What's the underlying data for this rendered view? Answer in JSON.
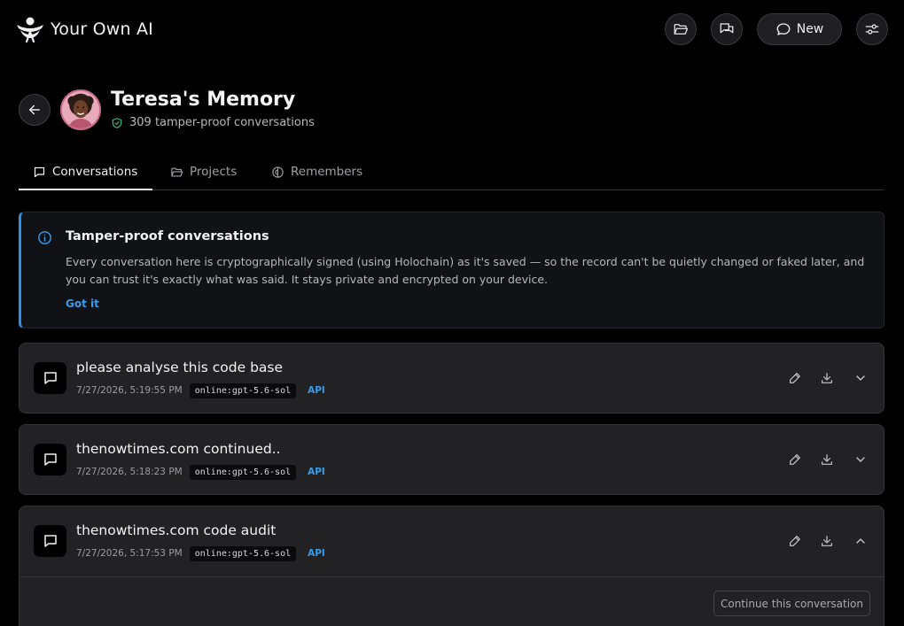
{
  "app": {
    "name": "Your Own AI"
  },
  "header": {
    "new_label": "New",
    "icons": [
      "folder-open-icon",
      "chats-icon",
      "chat-bubble-icon",
      "sliders-icon"
    ]
  },
  "profile": {
    "title": "Teresa's Memory",
    "subtitle": "309 tamper-proof conversations"
  },
  "tabs": [
    {
      "label": "Conversations",
      "icon": "message-square-icon",
      "active": true
    },
    {
      "label": "Projects",
      "icon": "folder-icon",
      "active": false
    },
    {
      "label": "Remembers",
      "icon": "brain-icon",
      "active": false
    }
  ],
  "info": {
    "title": "Tamper-proof conversations",
    "body": "Every conversation here is cryptographically signed (using Holochain) as it's saved — so the record can't be quietly changed or faked later, and you can trust it's exactly what was said. It stays private and encrypted on your device.",
    "dismiss_label": "Got it"
  },
  "conversations": [
    {
      "title": "please analyse this code base",
      "date": "7/27/2026, 5:19:55 PM",
      "model": "online:gpt-5.6-sol",
      "source": "API",
      "expanded": false
    },
    {
      "title": "thenowtimes.com continued..",
      "date": "7/27/2026, 5:18:23 PM",
      "model": "online:gpt-5.6-sol",
      "source": "API",
      "expanded": false
    },
    {
      "title": "thenowtimes.com code audit",
      "date": "7/27/2026, 5:17:53 PM",
      "model": "online:gpt-5.6-sol",
      "source": "API",
      "expanded": true,
      "continue_label": "Continue this conversation"
    }
  ],
  "colors": {
    "accent": "#3a9be8",
    "background": "#000000",
    "card": "#222225",
    "verified": "#3fbf7f"
  }
}
